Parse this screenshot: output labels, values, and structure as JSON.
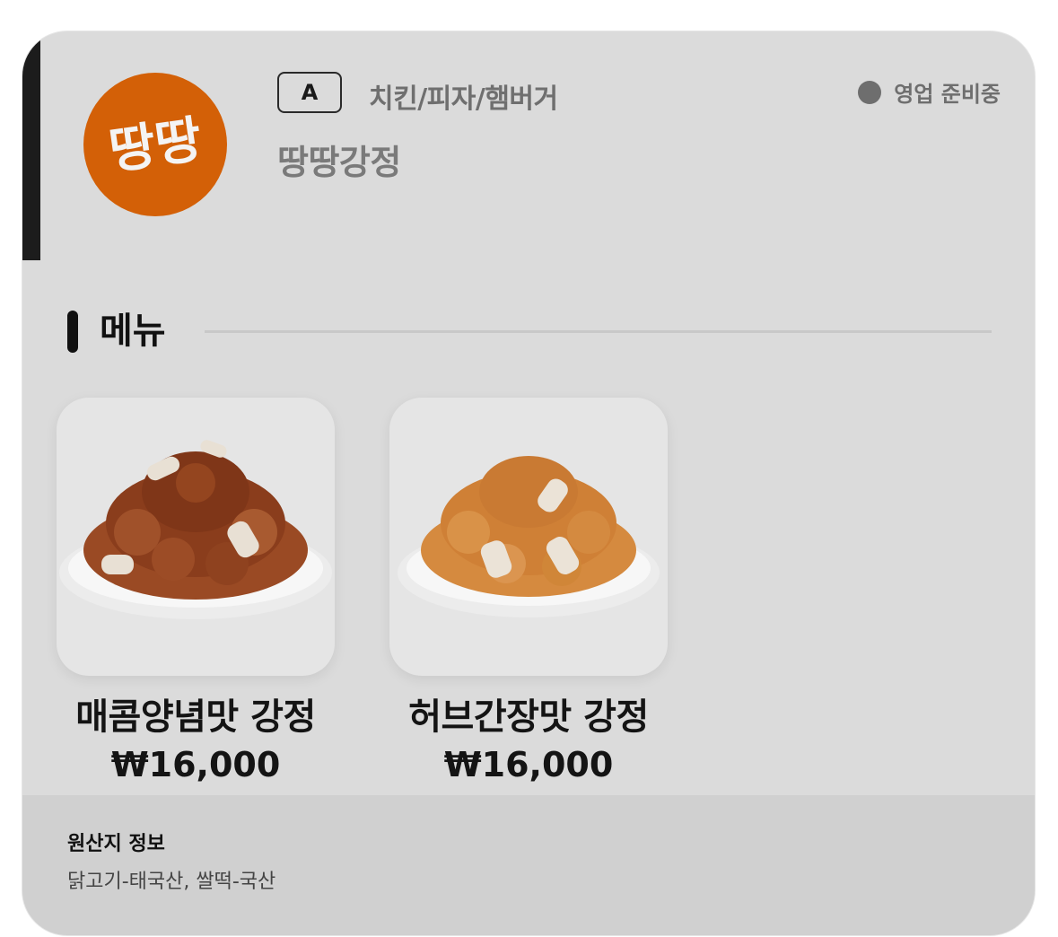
{
  "store": {
    "logo_text": "땅땅",
    "grade": "A",
    "category": "치킨/피자/햄버거",
    "name": "땅땅강정",
    "status": "영업 준비중"
  },
  "menu_section": {
    "title": "메뉴"
  },
  "menu": [
    {
      "name": "매콤양념맛 강정",
      "price": "₩16,000",
      "image": "spicy-gangjeong-image"
    },
    {
      "name": "허브간장맛 강정",
      "price": "₩16,000",
      "image": "herb-soy-gangjeong-image"
    }
  ],
  "origin": {
    "title": "원산지 정보",
    "text": "닭고기-태국산, 쌀떡-국산"
  },
  "colors": {
    "card_bg": "#dbdbdb",
    "logo_bg": "#d36007",
    "accent": "#1c1c1c",
    "origin_bg": "#d0d0d0"
  }
}
